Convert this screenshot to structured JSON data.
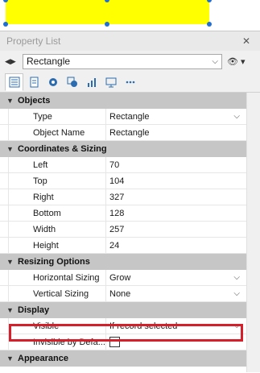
{
  "colors": {
    "shape_fill": "#ffff00",
    "handle": "#1f6fd6",
    "section_bg": "#c6c6c6",
    "highlight": "#d4202a"
  },
  "panel": {
    "title": "Property List",
    "close_glyph": "✕",
    "selected_object": "Rectangle",
    "eye_glyph": "👁",
    "eye_caret": "▾"
  },
  "toolbar": {
    "icons": [
      "properties-list-icon",
      "document-icon",
      "gear-icon",
      "shape-icon",
      "chart-icon",
      "monitor-icon",
      "more-icon"
    ]
  },
  "sections": {
    "objects": {
      "label": "Objects",
      "props": [
        {
          "name": "Type",
          "value": "Rectangle"
        },
        {
          "name": "Object Name",
          "value": "Rectangle"
        }
      ]
    },
    "coords": {
      "label": "Coordinates & Sizing",
      "props": [
        {
          "name": "Left",
          "value": "70"
        },
        {
          "name": "Top",
          "value": "104"
        },
        {
          "name": "Right",
          "value": "327"
        },
        {
          "name": "Bottom",
          "value": "128"
        },
        {
          "name": "Width",
          "value": "257"
        },
        {
          "name": "Height",
          "value": "24"
        }
      ]
    },
    "resizing": {
      "label": "Resizing Options",
      "props": [
        {
          "name": "Horizontal Sizing",
          "value": "Grow"
        },
        {
          "name": "Vertical Sizing",
          "value": "None"
        }
      ]
    },
    "display": {
      "label": "Display",
      "props": [
        {
          "name": "Visible",
          "value": "If record selected"
        },
        {
          "name": "Invisible by Defa..."
        }
      ]
    },
    "appearance": {
      "label": "Appearance"
    }
  }
}
